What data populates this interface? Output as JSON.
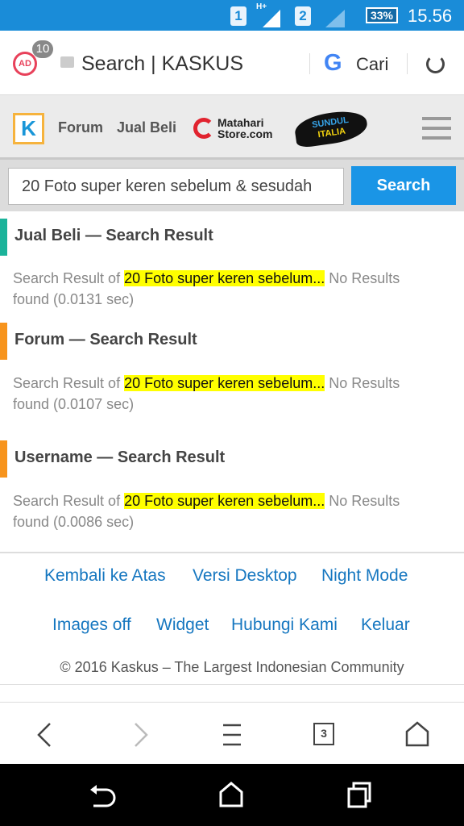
{
  "status_bar": {
    "sim1": "1",
    "network": "H+",
    "sim2": "2",
    "battery": "33%",
    "time": "15.56"
  },
  "browser": {
    "adblock_count": "10",
    "page_title": "Search | KASKUS",
    "search_label": "Cari"
  },
  "kaskus_nav": {
    "logo": "K",
    "items": [
      "Forum",
      "Jual Beli"
    ],
    "matahari": [
      "Matahari",
      "Store.com"
    ],
    "sundul": [
      "SUNDUL",
      "ITALIA"
    ]
  },
  "search": {
    "value": "20 Foto super keren sebelum & sesudah",
    "button": "Search"
  },
  "results": [
    {
      "title": "Jual Beli — Search Result",
      "prefix": "Search Result of ",
      "query": "20 Foto super keren sebelum...",
      "suffix": " No Results found (0.0131 sec)",
      "color": "#1bb39a"
    },
    {
      "title": "Forum — Search Result",
      "prefix": "Search Result of ",
      "query": "20 Foto super keren sebelum...",
      "suffix": " No Results found (0.0107 sec)",
      "color": "#f7941d"
    },
    {
      "title": "Username — Search Result",
      "prefix": "Search Result of ",
      "query": "20 Foto super keren sebelum...",
      "suffix": "  No Results found (0.0086 sec)",
      "color": "#f7941d"
    }
  ],
  "footer": {
    "links": [
      "Kembali ke Atas",
      "Versi Desktop",
      "Night Mode",
      "Images off",
      "Widget",
      "Hubungi Kami",
      "Keluar"
    ],
    "copyright": "© 2016 Kaskus – The Largest Indonesian Community"
  },
  "bottom_nav": {
    "tab_count": "3"
  }
}
